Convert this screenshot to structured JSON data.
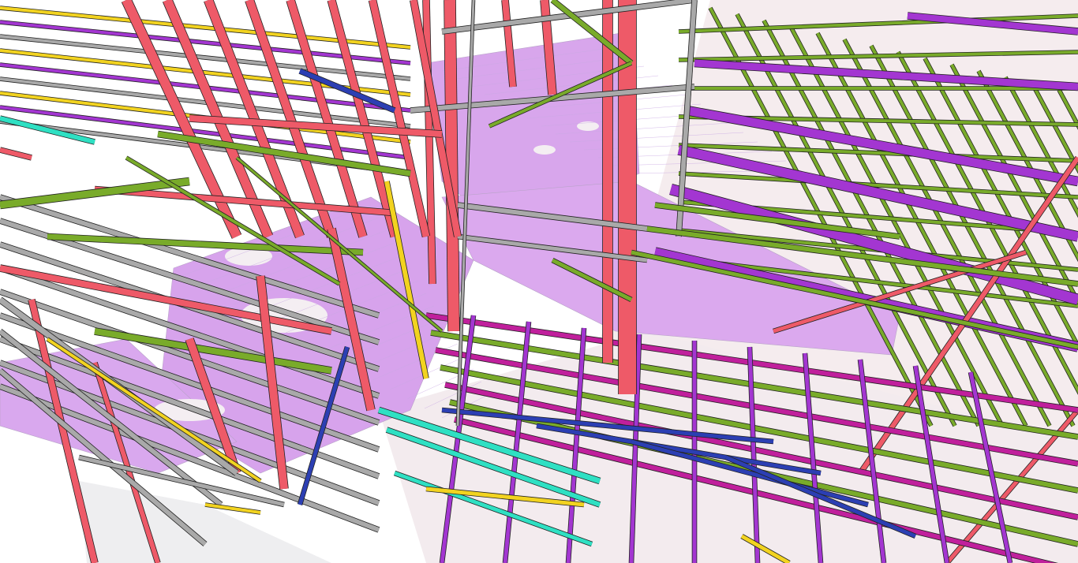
{
  "scene": {
    "subject": "structural-steel-3d-model",
    "colors": {
      "background": "#ffffff",
      "floor_slab": "#d8a6ec",
      "ground_slab": "#f5ecee",
      "column_red": "#ee5a68",
      "beam_gray": "#a9a9a9",
      "beam_green": "#79ab2a",
      "beam_purple": "#a336d1",
      "beam_magenta": "#c0209c",
      "beam_yellow": "#f2d320",
      "beam_cyan": "#2fe0c3",
      "beam_blue": "#2c3fb3",
      "edge_dark": "#222222"
    }
  }
}
